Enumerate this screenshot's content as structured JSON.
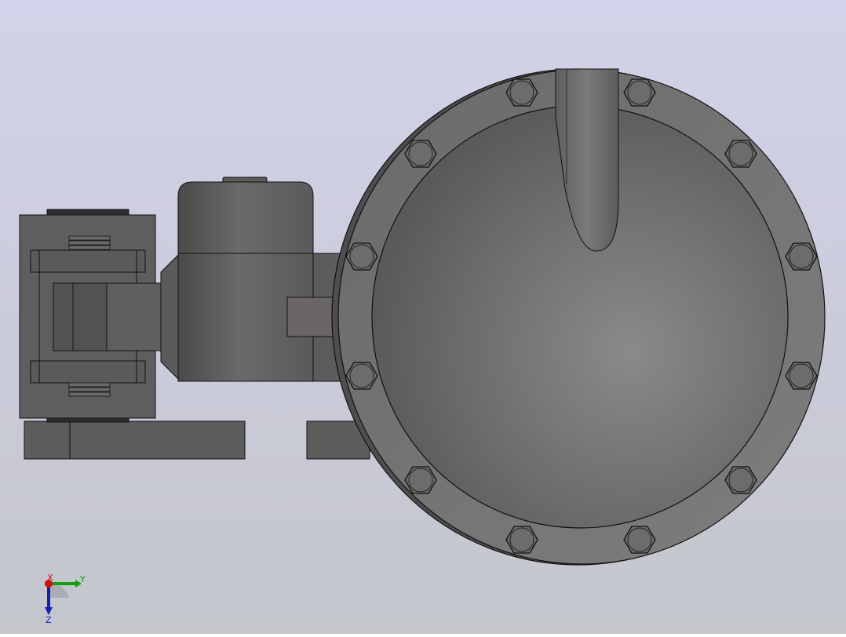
{
  "viewport": {
    "background_top": "#D2D2EA",
    "background_bottom": "#C2C4CC",
    "part_color": "#6E6E6E",
    "edge_color": "#1A1A1A"
  },
  "triad": {
    "x_label": "X",
    "y_label": "Y",
    "z_label": "Z",
    "x_color": "#D01010",
    "y_color": "#10A010",
    "z_color": "#1020B0"
  }
}
